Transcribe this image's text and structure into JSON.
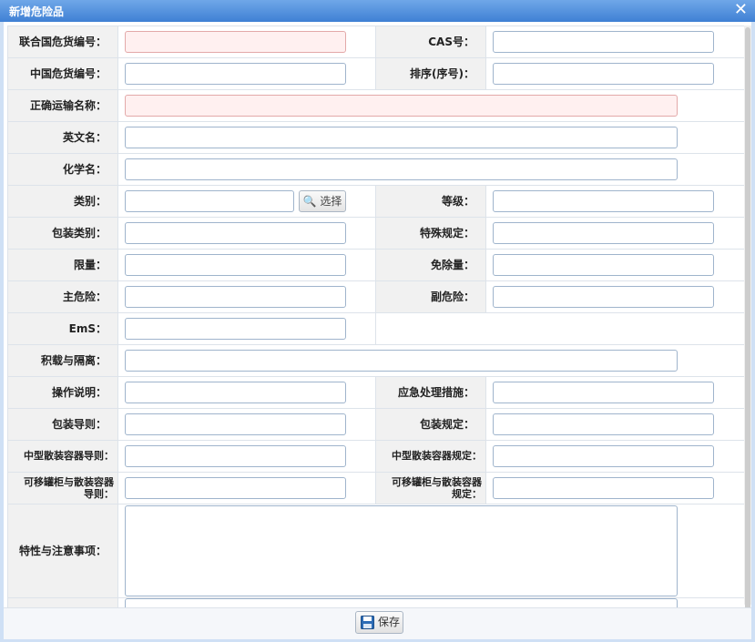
{
  "dialog": {
    "title": "新增危险品",
    "close_icon": "close-icon"
  },
  "fields": {
    "un_no": "联合国危货编号：",
    "cas_no": "CAS号：",
    "cn_no": "中国危货编号：",
    "sort": "排序(序号)：",
    "ship_name": "正确运输名称：",
    "en_name": "英文名：",
    "chem_name": "化学名：",
    "category": "类别：",
    "grade": "等级：",
    "pack_type": "包装类别：",
    "special": "特殊规定：",
    "limit": "限量：",
    "exempt": "免除量：",
    "main_risk": "主危险：",
    "sub_risk": "副危险：",
    "ems": "EmS：",
    "stowage": "积载与隔离：",
    "operation": "操作说明：",
    "emergency": "应急处理措施：",
    "pack_guide": "包装导则：",
    "pack_rule": "包装规定：",
    "ibc_guide": "中型散装容器导则：",
    "ibc_rule": "中型散装容器规定：",
    "tank_guide_1": "可移罐柜与散装容器",
    "tank_guide_2": "导则：",
    "tank_rule_1": "可移罐柜与散装容器",
    "tank_rule_2": "规定：",
    "notes": "特性与注意事项："
  },
  "buttons": {
    "select": "选择",
    "select_icon": "search-icon",
    "save": "保存",
    "save_icon": "floppy-disk-icon"
  },
  "colors": {
    "titlebar": "#4a8ad9",
    "required_bg": "#fff0f0",
    "label_bg": "#f1f1f1"
  }
}
